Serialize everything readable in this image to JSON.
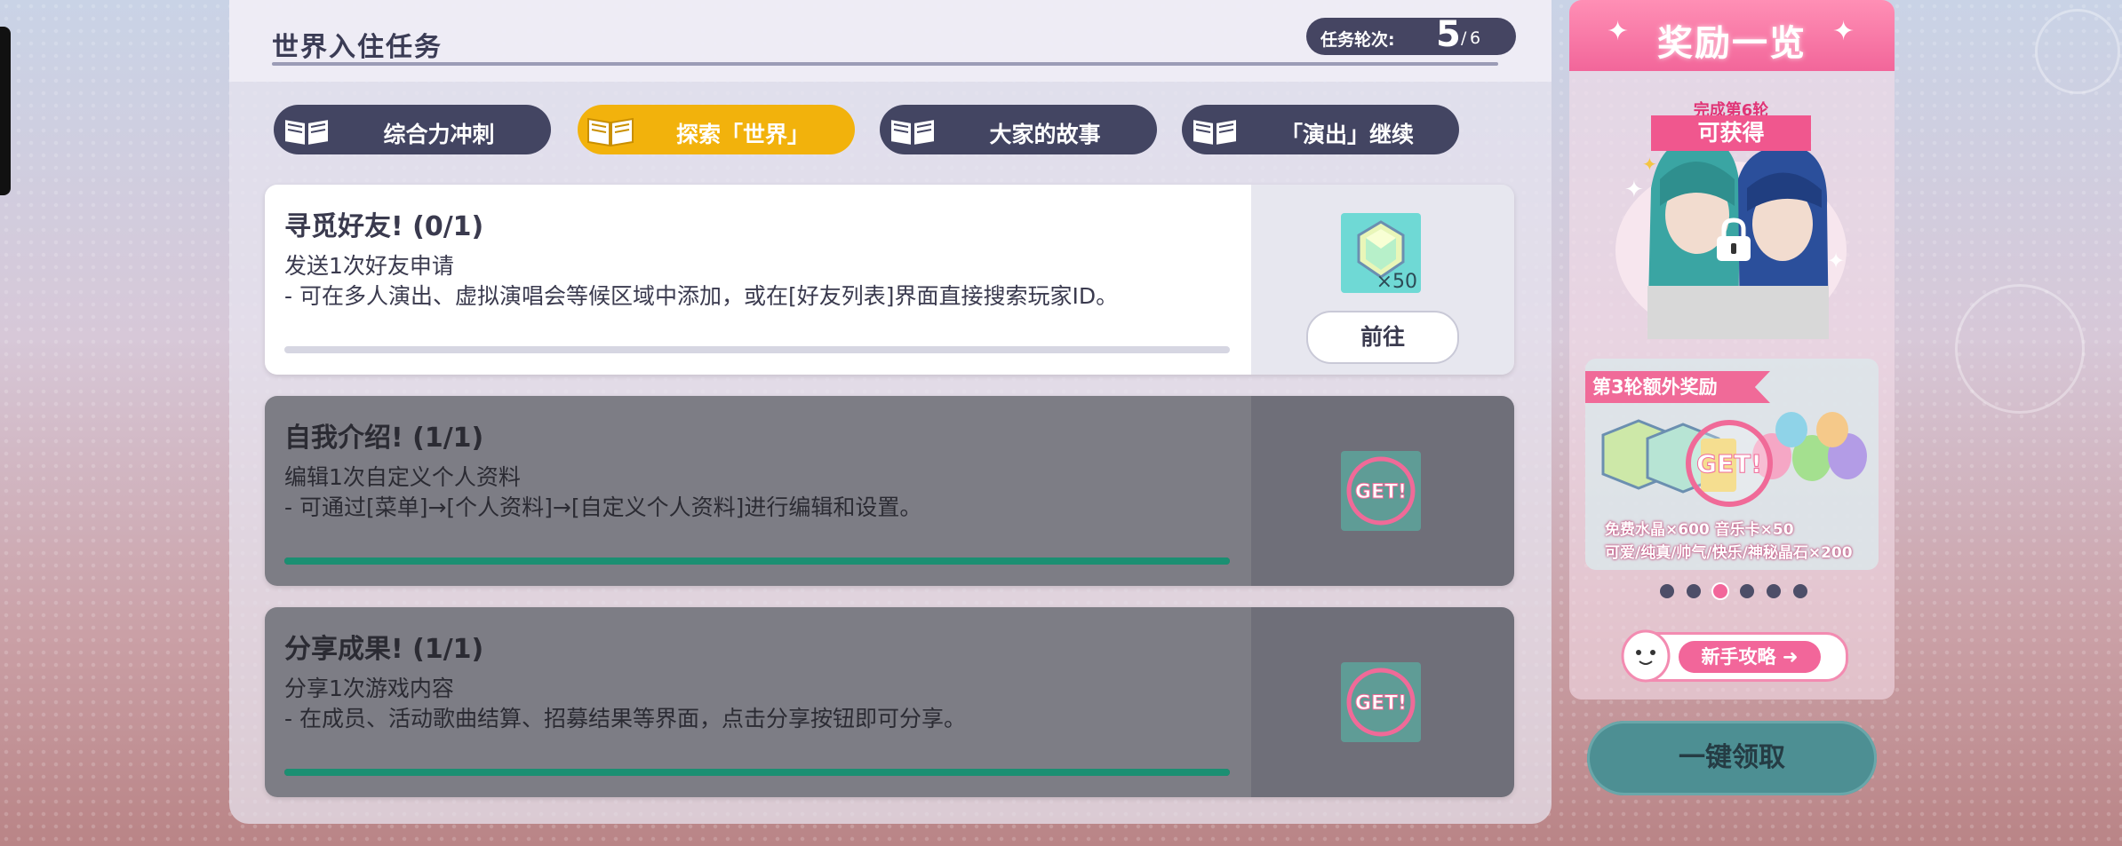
{
  "header": {
    "title": "世界入住任务",
    "round_label": "任务轮次:",
    "round_current": "5",
    "round_total": "6"
  },
  "tabs": [
    {
      "label": "综合力冲刺",
      "active": false
    },
    {
      "label": "探索「世界」",
      "active": true
    },
    {
      "label": "大家的故事",
      "active": false
    },
    {
      "label": "「演出」继续",
      "active": false
    }
  ],
  "tasks": [
    {
      "title": "寻觅好友!  (0/1)",
      "desc1": "发送1次好友申请",
      "desc2": "- 可在多人演出、虚拟演唱会等候区域中添加，或在[好友列表]界面直接搜索玩家ID。",
      "progress": 0,
      "reward_qty": "×50",
      "action_label": "前往",
      "completed": false
    },
    {
      "title": "自我介绍!  (1/1)",
      "desc1": "编辑1次自定义个人资料",
      "desc2": "- 可通过[菜单]→[个人资料]→[自定义个人资料]进行编辑和设置。",
      "progress": 1,
      "badge": "GET!",
      "completed": true
    },
    {
      "title": "分享成果!  (1/1)",
      "desc1": "分享1次游戏内容",
      "desc2": "- 在成员、活动歌曲结算、招募结果等界面，点击分享按钮即可分享。",
      "progress": 1,
      "badge": "GET!",
      "completed": true
    }
  ],
  "rewards": {
    "title": "奖励一览",
    "featured_small": "完成第6轮",
    "featured_main": "可获得",
    "extra_tag": "第3轮额外奖励",
    "extra_badge": "GET!",
    "extra_line1": "免费水晶×600    音乐卡×50",
    "extra_line2": "可爱/纯真/帅气/快乐/神秘晶石×200",
    "dots_total": 6,
    "dots_active": 3,
    "guide_label": "新手攻略"
  },
  "claim_all_label": "一键领取",
  "colors": {
    "accent_yellow": "#f2b20c",
    "tab_dark": "#434562",
    "pink": "#f2669a",
    "progress_done": "#1b8f72",
    "teal_button": "#4d8f93"
  }
}
